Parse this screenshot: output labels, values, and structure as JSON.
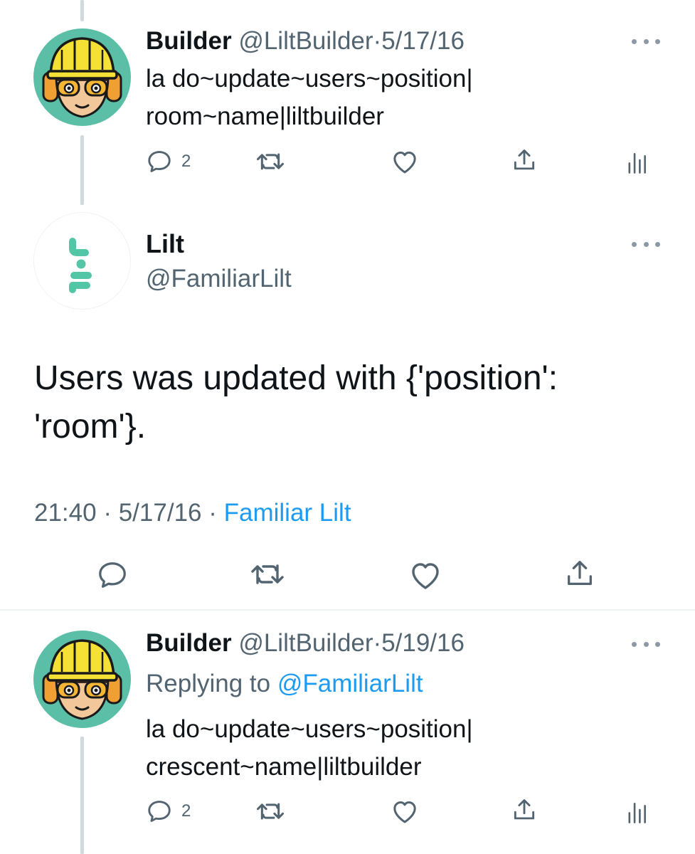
{
  "tweets": [
    {
      "name": "Builder",
      "handle": "@LiltBuilder",
      "sep": "·",
      "date": "5/17/16",
      "text_line1": "la do~update~users~position|",
      "text_line2": "room~name|liltbuilder",
      "reply_count": "2",
      "avatar_icon": "builder-hardhat-avatar"
    },
    {
      "name": "Lilt",
      "handle": "@FamiliarLilt",
      "text_line1": "Users was updated with {'position':",
      "text_line2": "'room'}.",
      "time": "21:40",
      "sep1": "·",
      "date": "5/17/16",
      "sep2": "·",
      "source": "Familiar Lilt",
      "avatar_icon": "lilt-logo-avatar"
    },
    {
      "name": "Builder",
      "handle": "@LiltBuilder",
      "sep": "·",
      "date": "5/19/16",
      "replying_prefix": "Replying to",
      "replying_to": "@FamiliarLilt",
      "text_line1": "la do~update~users~position|",
      "text_line2": "crescent~name|liltbuilder",
      "reply_count": "2",
      "avatar_icon": "builder-hardhat-avatar"
    }
  ],
  "colors": {
    "link": "#1d9bf0",
    "muted": "#536471",
    "text": "#0f1419",
    "avatar_bg": "#5bbfa8",
    "helmet": "#f5e135"
  }
}
